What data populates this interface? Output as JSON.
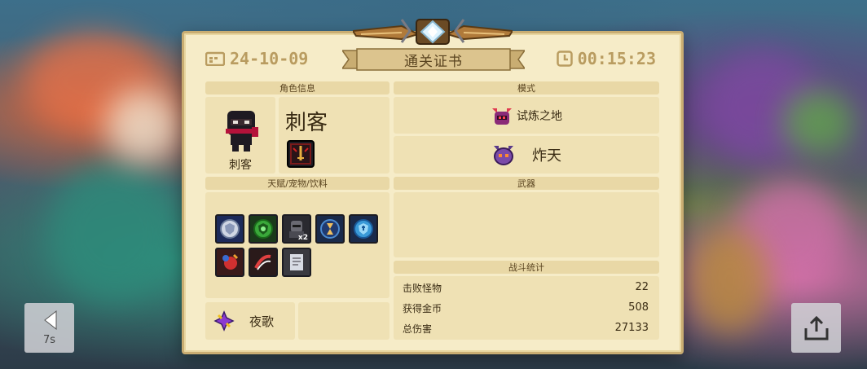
{
  "certificate": {
    "title": "通关证书",
    "date": "24-10-09",
    "time": "00:15:23"
  },
  "character": {
    "header": "角色信息",
    "name_small": "刺客",
    "name_big": "刺客"
  },
  "mode": {
    "header": "模式",
    "primary": "试炼之地",
    "secondary": "炸天"
  },
  "talents": {
    "header": "天赋/宠物/饮料",
    "icons": [
      "shield-badge-icon",
      "green-shield-icon",
      "armored-head-icon",
      "hourglass-icon",
      "blue-cross-shield-icon",
      "fire-bomb-icon",
      "claw-slash-icon",
      "scroll-note-icon"
    ],
    "armored_multiplier": "x2"
  },
  "weapon": {
    "header": "武器"
  },
  "skill": {
    "label": "夜歌"
  },
  "stats": {
    "header": "战斗统计",
    "rows": [
      {
        "label": "击败怪物",
        "value": "22"
      },
      {
        "label": "获得金币",
        "value": "508"
      },
      {
        "label": "总伤害",
        "value": "27133"
      }
    ]
  },
  "controls": {
    "back_countdown": "7s"
  },
  "colors": {
    "card_bg": "#f6ecc8",
    "header_bg": "#e9d8a6",
    "accent_gold": "#b99c60",
    "text_dark": "#3a2c14"
  }
}
